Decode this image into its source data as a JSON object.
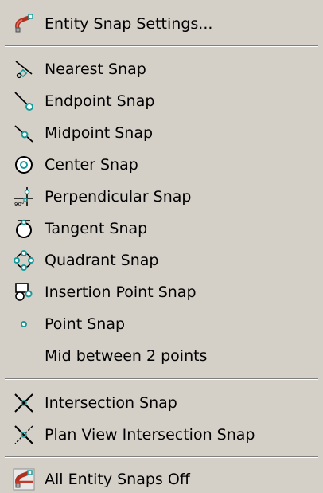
{
  "menu": {
    "items": [
      {
        "label": "Entity Snap Settings...",
        "icon": "snap-settings-icon"
      },
      {
        "label": "Nearest Snap",
        "icon": "nearest-snap-icon"
      },
      {
        "label": "Endpoint Snap",
        "icon": "endpoint-snap-icon"
      },
      {
        "label": "Midpoint Snap",
        "icon": "midpoint-snap-icon"
      },
      {
        "label": "Center Snap",
        "icon": "center-snap-icon"
      },
      {
        "label": "Perpendicular Snap",
        "icon": "perpendicular-snap-icon",
        "icon_text": "90°"
      },
      {
        "label": "Tangent Snap",
        "icon": "tangent-snap-icon"
      },
      {
        "label": "Quadrant Snap",
        "icon": "quadrant-snap-icon"
      },
      {
        "label": "Insertion Point Snap",
        "icon": "insertion-point-snap-icon"
      },
      {
        "label": "Point Snap",
        "icon": "point-snap-icon"
      },
      {
        "label": "Mid between 2 points",
        "icon": ""
      },
      {
        "label": "Intersection Snap",
        "icon": "intersection-snap-icon"
      },
      {
        "label": "Plan View Intersection Snap",
        "icon": "plan-view-intersection-snap-icon"
      },
      {
        "label": "All Entity Snaps Off",
        "icon": "all-snaps-off-icon"
      }
    ]
  },
  "colors": {
    "background": "#d4d0c8",
    "snap_marker": "#1a9a9a",
    "magnet_red": "#c0392b"
  }
}
